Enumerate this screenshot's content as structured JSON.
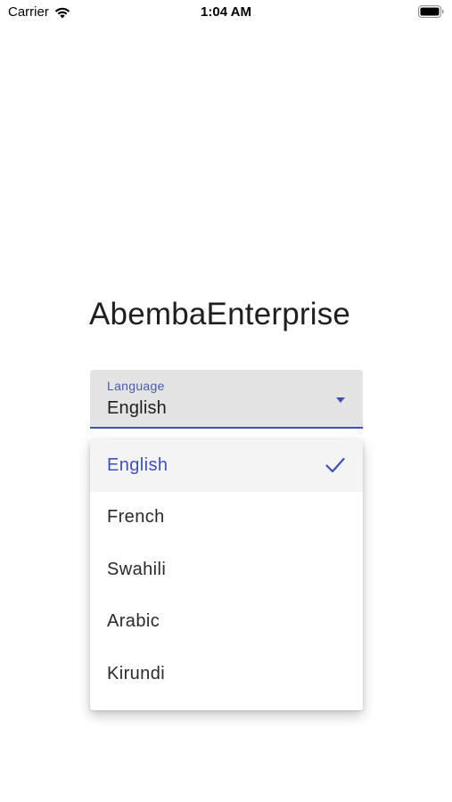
{
  "status_bar": {
    "carrier": "Carrier",
    "time": "1:04 AM",
    "wifi_icon": "wifi-icon",
    "battery_icon": "battery-icon"
  },
  "app": {
    "title": "AbembaEnterprise"
  },
  "language_field": {
    "label": "Language",
    "value": "English",
    "caret_icon": "chevron-down-icon"
  },
  "language_menu": {
    "selected": "English",
    "check_icon": "check-icon",
    "options": [
      "English",
      "French",
      "Swahili",
      "Arabic",
      "Kirundi"
    ]
  },
  "colors": {
    "accent": "#3f51b5",
    "field_background": "#e3e3e3",
    "selected_item_background": "#f4f4f4"
  }
}
